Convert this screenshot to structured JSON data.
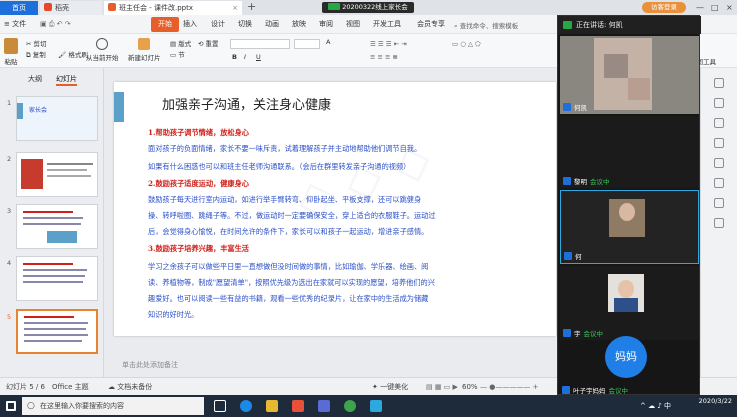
{
  "tabs": {
    "home": "首页",
    "doc": "稻壳",
    "pptx": "班主任会 - 课件改.pptx",
    "new_tab": "+"
  },
  "meeting": {
    "title": "20200322线上家长会",
    "login": "访客登录",
    "header": "正在讲话: 何凯"
  },
  "menu": {
    "file": "文件",
    "items": [
      "开始",
      "插入",
      "设计",
      "切换",
      "动画",
      "放映",
      "审阅",
      "视图",
      "开发工具",
      "会员专享"
    ],
    "search": "查找命令、搜索模板"
  },
  "ribbon": {
    "paste": "粘贴",
    "cut": "剪切",
    "copy": "复制",
    "format_painter": "格式刷",
    "from_current": "从当前开始",
    "new_slide": "新建幻灯片",
    "layout": "版式",
    "section": "节",
    "reset": "重置",
    "font_size_up": "A",
    "bold": "B",
    "italic": "I",
    "underline": "U",
    "drawing_tools": "绘图工具"
  },
  "left_panel": {
    "tab_outline": "大纲",
    "tab_slides": "幻灯片",
    "thumbs": [
      {
        "num": "1",
        "text": "家长会"
      },
      {
        "num": "2",
        "text": ""
      },
      {
        "num": "3",
        "text": ""
      },
      {
        "num": "4",
        "text": ""
      },
      {
        "num": "5",
        "text": ""
      }
    ]
  },
  "slide": {
    "title": "加强亲子沟通，关注身心健康",
    "lines": [
      {
        "style": "red",
        "text": "1.帮助孩子调节情绪，放松身心"
      },
      {
        "style": "blue",
        "text": "    面对孩子的负面情绪，家长不要一味斥责，试着理解孩子并主动地帮助他们调节自我。"
      },
      {
        "style": "blue",
        "text": "如果有什么困惑也可以和班主任老师沟通联系。（会后在群里转发亲子沟通的视频）"
      },
      {
        "style": "red",
        "text": "2.鼓励孩子适度运动，健康身心"
      },
      {
        "style": "blue",
        "text": "    鼓励孩子每天进行室内运动，如进行举手臂转弯、仰卧起坐、平板支撑，还可以跳健身"
      },
      {
        "style": "blue",
        "text": "操、转呼啦圈、跳绳子等。不过，做运动时一定要确保安全，穿上适合的衣服鞋子。运动过"
      },
      {
        "style": "blue",
        "text": "后，会觉得身心愉悦，在时间允许的条件下，家长可以和孩子一起运动，增进亲子感情。"
      },
      {
        "style": "red",
        "text": "3.鼓励孩子培养兴趣，丰富生活"
      },
      {
        "style": "blue",
        "text": "    学习之余孩子可以做些平日里一直想做但没时间做的事情，比如瑜伽、学乐器、绘画、阅"
      },
      {
        "style": "blue",
        "text": "读、养植物等，制成\"愿望清单\"，按照优先级为选出在家就可以实现的愿望，培养他们的兴"
      },
      {
        "style": "blue",
        "text": "趣爱好。也可以阅读一些有益的书籍，观看一些优秀的纪录片，让在家中的生活成为储藏"
      },
      {
        "style": "blue",
        "text": "知识的好时光。"
      }
    ],
    "notes_placeholder": "单击此处添加备注"
  },
  "video_call": {
    "tiles": [
      {
        "label": "何凯",
        "status": ""
      },
      {
        "label": "黎明",
        "status": "会议中"
      },
      {
        "label": "何",
        "status": ""
      },
      {
        "label": "宇",
        "status": "会议中"
      }
    ],
    "big_avatar": "妈妈",
    "bottom_label": "叶子宇妈妈",
    "bottom_status": "会议中"
  },
  "statusbar": {
    "slide_index": "幻灯片 5 / 6",
    "theme": "Office 主题",
    "backup": "文档未备份",
    "beautify": "一键美化",
    "zoom": "60%"
  },
  "taskbar": {
    "search_placeholder": "在这里输入你要搜索的内容",
    "time": "",
    "date": "2020/3/22"
  },
  "colors": {
    "accent": "#e65f2b",
    "wps_blue": "#1e6fd9",
    "red_heading": "#d0201a",
    "blue_text": "#2a4fc9"
  }
}
